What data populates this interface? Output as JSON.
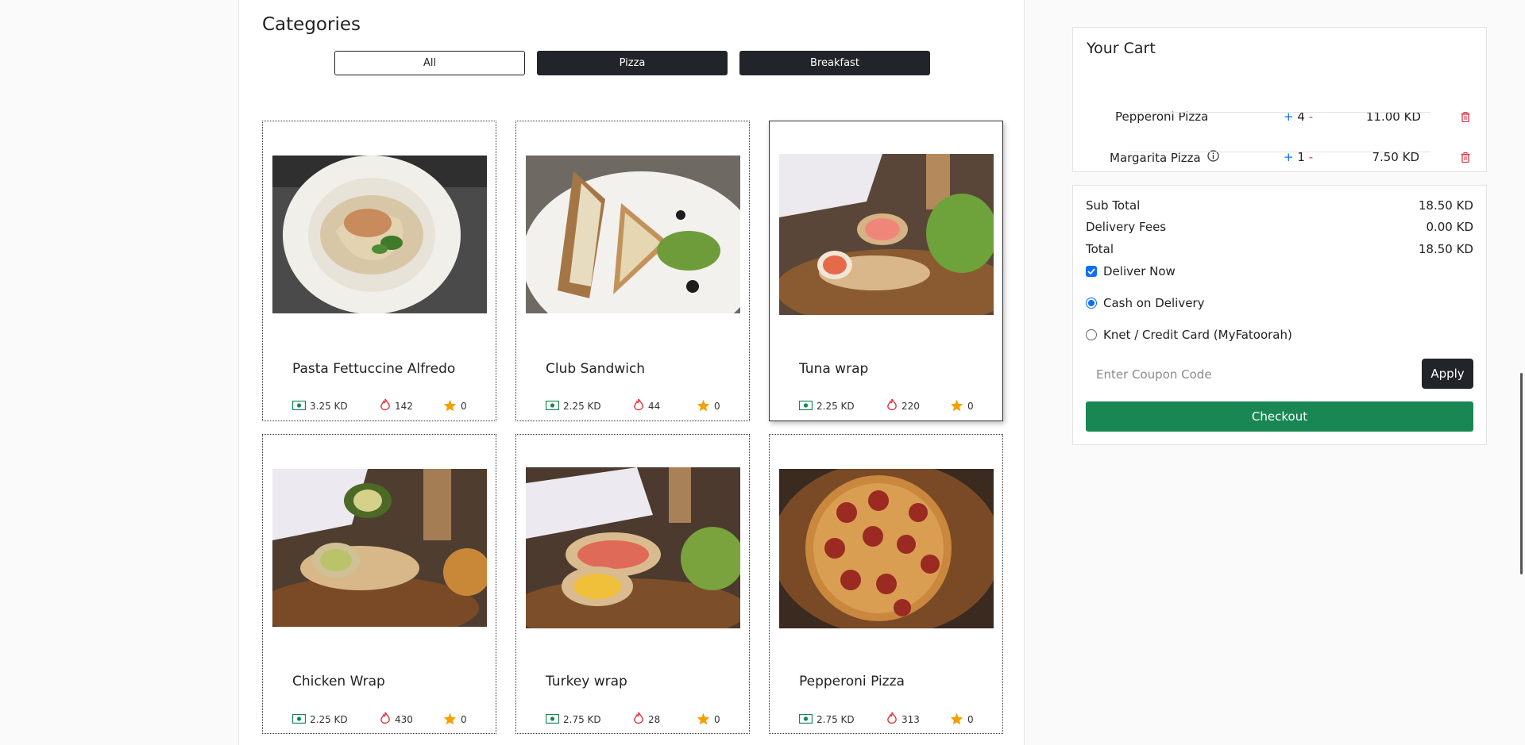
{
  "categories": {
    "title": "Categories",
    "buttons": [
      "All",
      "Pizza",
      "Breakfast"
    ]
  },
  "products": [
    {
      "name": "Pasta Fettuccine Alfredo",
      "price": "3.25 KD",
      "calories": "142",
      "rating": "0"
    },
    {
      "name": "Club Sandwich",
      "price": "2.25 KD",
      "calories": "44",
      "rating": "0"
    },
    {
      "name": "Tuna wrap",
      "price": "2.25 KD",
      "calories": "220",
      "rating": "0"
    },
    {
      "name": "Chicken Wrap",
      "price": "2.25 KD",
      "calories": "430",
      "rating": "0"
    },
    {
      "name": "Turkey wrap",
      "price": "2.75 KD",
      "calories": "28",
      "rating": "0"
    },
    {
      "name": "Pepperoni Pizza",
      "price": "2.75 KD",
      "calories": "313",
      "rating": "0"
    }
  ],
  "cart": {
    "title": "Your Cart",
    "items": [
      {
        "name": "Pepperoni Pizza",
        "plus": "+",
        "qty": "4",
        "minus": "-",
        "price": "11.00 KD"
      },
      {
        "name": "Margarita Pizza",
        "plus": "+",
        "qty": "1",
        "minus": "-",
        "price": "7.50 KD"
      }
    ]
  },
  "summary": {
    "subtotal_label": "Sub Total",
    "subtotal": "18.50 KD",
    "delivery_label": "Delivery Fees",
    "delivery": "0.00 KD",
    "total_label": "Total",
    "total": "18.50 KD",
    "deliver_now": "Deliver Now",
    "cash": "Cash on Delivery",
    "knet": "Knet / Credit Card (MyFatoorah)",
    "coupon_placeholder": "Enter Coupon Code",
    "apply": "Apply",
    "checkout": "Checkout"
  },
  "colors": {
    "accent": "#0d6efd",
    "danger": "#dc3545",
    "success": "#198754",
    "dark": "#212529",
    "money": "#198754",
    "star": "#f5a000"
  }
}
